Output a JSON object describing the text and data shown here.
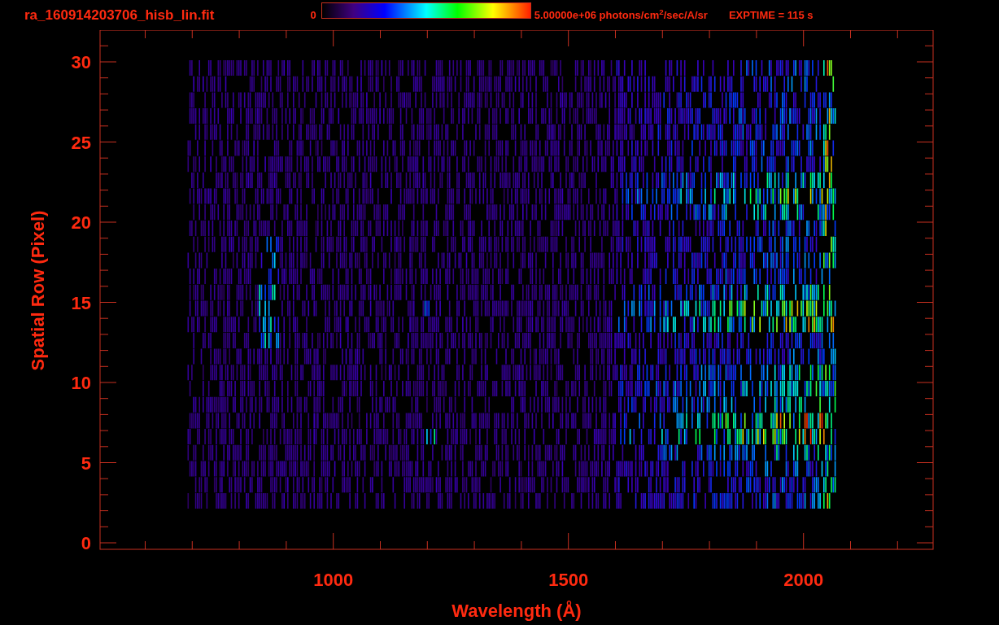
{
  "header": {
    "title": "ra_160914203706_hisb_lin.fit",
    "colorbar": {
      "min_label": "0",
      "max_label": "5.00000e+06 photons/cm$^{2}$/sec/A/sr"
    },
    "exposure": "EXPTIME = 115 s"
  },
  "plot": {
    "xlabel": "Wavelength (Å)",
    "ylabel": "Spatial Row (Pixel)",
    "xticks": [
      "1000",
      "1500",
      "2000"
    ],
    "yticks": [
      "30",
      "25",
      "20",
      "15",
      "10",
      "5",
      "0"
    ]
  }
}
